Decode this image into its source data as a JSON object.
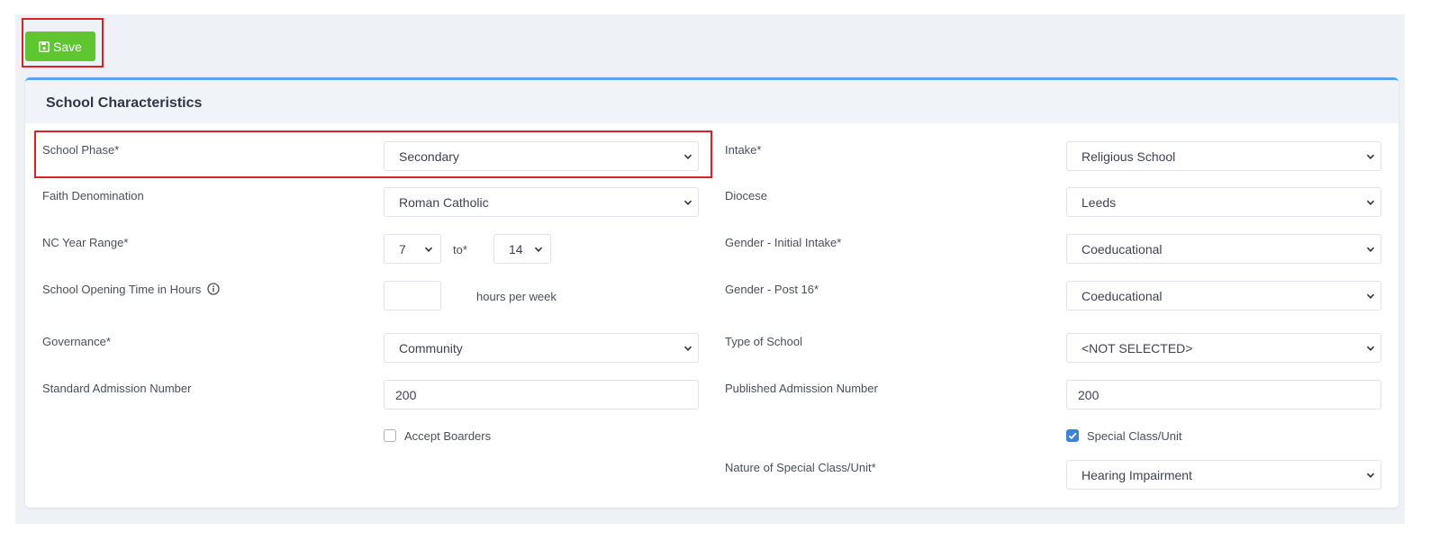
{
  "toolbar": {
    "save_label": "Save"
  },
  "card": {
    "title": "School Characteristics"
  },
  "left": {
    "school_phase": {
      "label": "School Phase*",
      "value": "Secondary"
    },
    "faith": {
      "label": "Faith Denomination",
      "value": "Roman Catholic"
    },
    "nc_year": {
      "label": "NC Year Range*",
      "from": "7",
      "to_label": "to*",
      "to": "14"
    },
    "opening_time": {
      "label": "School Opening Time in Hours",
      "value": "",
      "unit": "hours per week"
    },
    "governance": {
      "label": "Governance*",
      "value": "Community"
    },
    "san": {
      "label": "Standard Admission Number",
      "value": "200"
    },
    "accept_boarders": {
      "label": "Accept Boarders",
      "checked": false
    }
  },
  "right": {
    "intake": {
      "label": "Intake*",
      "value": "Religious School"
    },
    "diocese": {
      "label": "Diocese",
      "value": "Leeds"
    },
    "gender_initial": {
      "label": "Gender - Initial Intake*",
      "value": "Coeducational"
    },
    "gender_post16": {
      "label": "Gender - Post 16*",
      "value": "Coeducational"
    },
    "type_of_school": {
      "label": "Type of School",
      "value": "<NOT SELECTED>"
    },
    "pan": {
      "label": "Published Admission Number",
      "value": "200"
    },
    "special_class": {
      "label": "Special Class/Unit",
      "checked": true
    },
    "nature_special": {
      "label": "Nature of Special Class/Unit*",
      "value": "Hearing Impairment"
    }
  },
  "colors": {
    "save": "#5ec72f",
    "accent": "#5aa2ee",
    "highlight": "#e01e26",
    "checkbox": "#3d82d4"
  },
  "icons": [
    "save-icon",
    "info-icon",
    "chevron-down-icon",
    "check-icon"
  ]
}
